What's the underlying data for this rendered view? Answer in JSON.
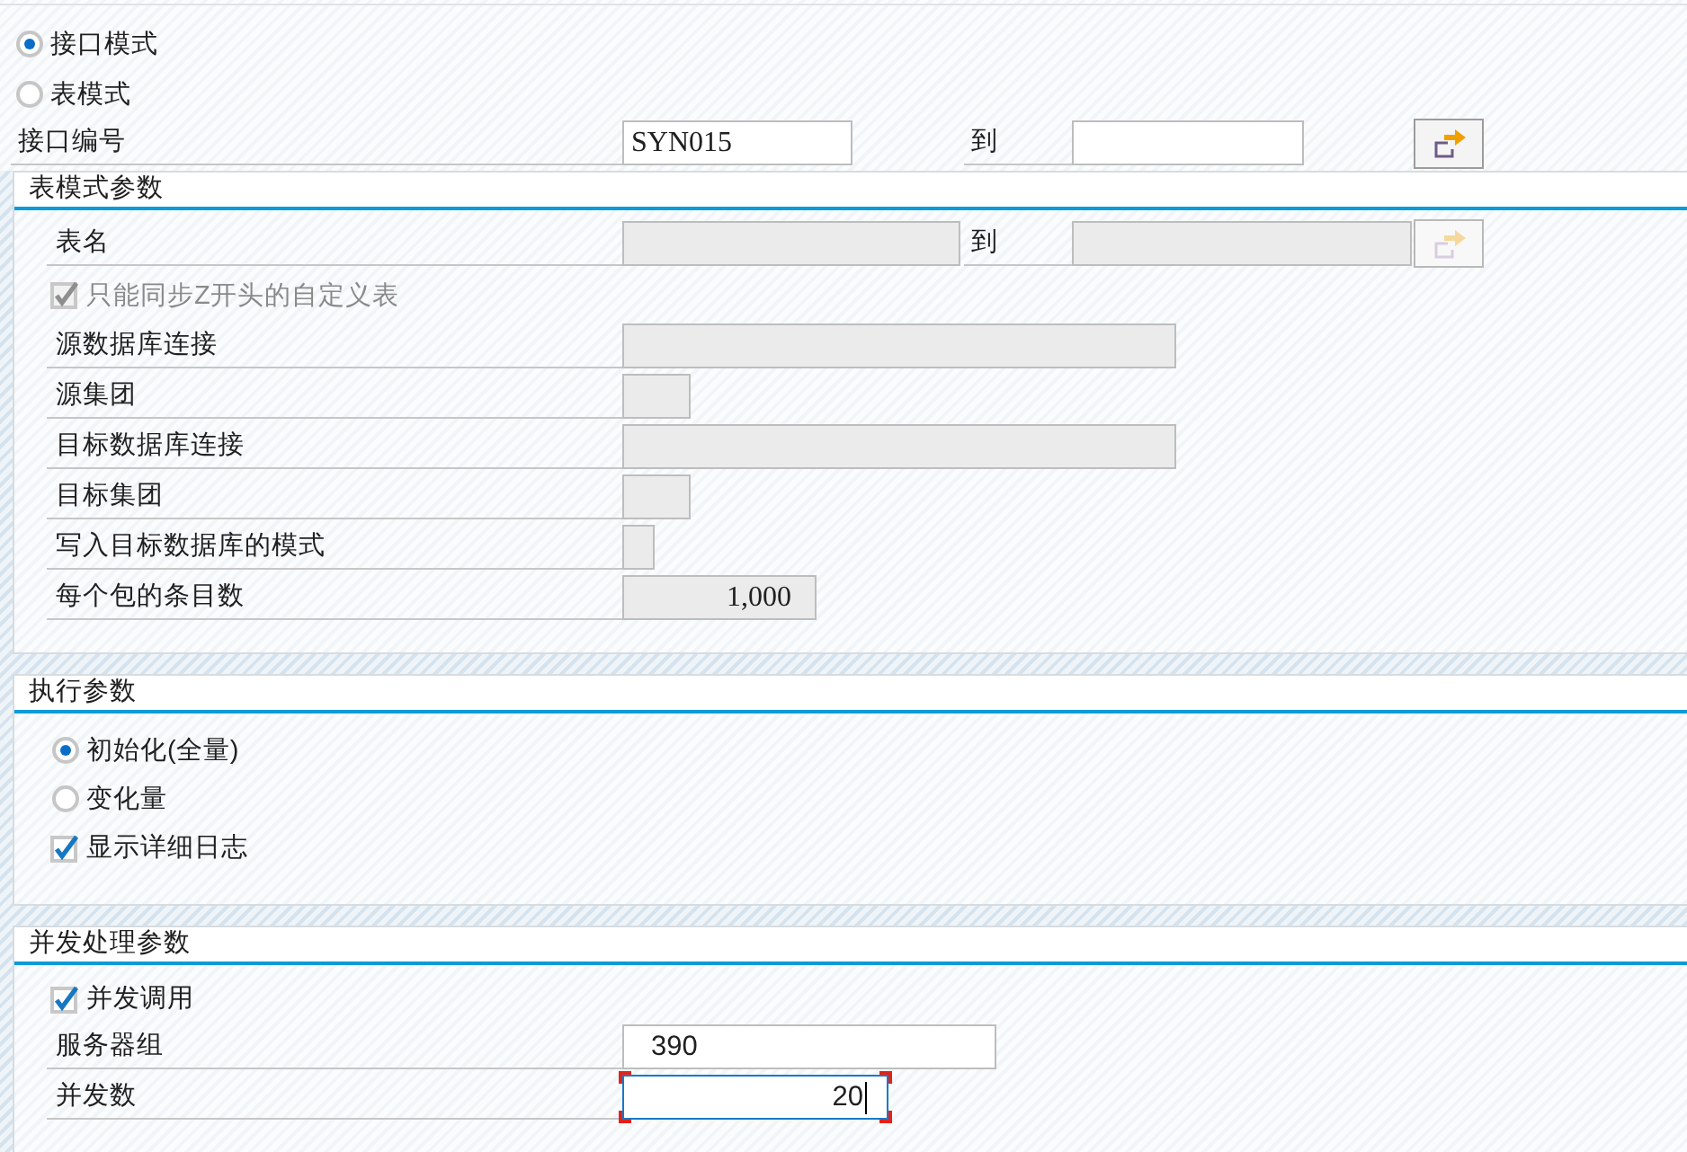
{
  "mode_options": [
    {
      "label": "接口模式",
      "selected": true
    },
    {
      "label": "表模式",
      "selected": false
    }
  ],
  "interface_number": {
    "label": "接口编号",
    "value": "SYN015",
    "to_label": "到",
    "disabled": false
  },
  "table_mode_params": {
    "title": "表模式参数",
    "table_name": {
      "label": "表名",
      "to_label": "到",
      "disabled": true
    },
    "only_z_tables": {
      "label": "只能同步Z开头的自定义表",
      "checked": true,
      "disabled": true
    },
    "fields": [
      {
        "label": "源数据库连接",
        "kind": "connection",
        "disabled": true
      },
      {
        "label": "源集团",
        "kind": "client",
        "disabled": true
      },
      {
        "label": "目标数据库连接",
        "kind": "connection",
        "disabled": true
      },
      {
        "label": "目标集团",
        "kind": "client",
        "disabled": true
      },
      {
        "label": "写入目标数据库的模式",
        "kind": "flag",
        "disabled": true
      },
      {
        "label": "每个包的条目数",
        "kind": "count",
        "value": "1,000",
        "disabled": true
      }
    ]
  },
  "execution_params": {
    "title": "执行参数",
    "options": [
      {
        "label": "初始化(全量)",
        "selected": true
      },
      {
        "label": "变化量",
        "selected": false
      }
    ],
    "detailed_log": {
      "label": "显示详细日志",
      "checked": true,
      "disabled": false
    }
  },
  "parallel_params": {
    "title": "并发处理参数",
    "parallel_call": {
      "label": "并发调用",
      "checked": true,
      "disabled": false
    },
    "fields": [
      {
        "label": "服务器组",
        "kind": "text",
        "value": "390",
        "disabled": false,
        "focused": false
      },
      {
        "label": "并发数",
        "kind": "number",
        "value": "20",
        "disabled": false,
        "focused": true
      }
    ]
  }
}
